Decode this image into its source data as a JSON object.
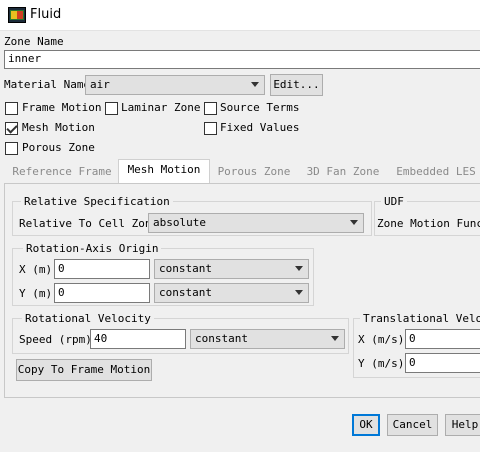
{
  "window": {
    "title": "Fluid",
    "icon": "fluent-app-icon"
  },
  "zone_name": {
    "label": "Zone Name",
    "value": "inner"
  },
  "material": {
    "label": "Material Name",
    "value": "air",
    "edit_button": "Edit..."
  },
  "options": [
    {
      "label": "Frame Motion",
      "checked": false
    },
    {
      "label": "Laminar Zone",
      "checked": false
    },
    {
      "label": "Source Terms",
      "checked": false
    },
    {
      "label": "Mesh Motion",
      "checked": true
    },
    {
      "label": "Fixed Values",
      "checked": false
    },
    {
      "label": "Porous Zone",
      "checked": false
    }
  ],
  "tabs": [
    "Reference Frame",
    "Mesh Motion",
    "Porous Zone",
    "3D Fan Zone",
    "Embedded LES"
  ],
  "active_tab": "Mesh Motion",
  "relative_spec": {
    "title": "Relative Specification",
    "label": "Relative To Cell Zone",
    "value": "absolute"
  },
  "udf": {
    "title": "UDF",
    "label": "Zone Motion Funct"
  },
  "rotation_axis": {
    "title": "Rotation-Axis Origin",
    "x": {
      "label": "X (m)",
      "value": "0",
      "profile": "constant"
    },
    "y": {
      "label": "Y (m)",
      "value": "0",
      "profile": "constant"
    }
  },
  "rotational_velocity": {
    "title": "Rotational Velocity",
    "speed": {
      "label": "Speed (rpm)",
      "value": "40",
      "profile": "constant"
    }
  },
  "translational_velocity": {
    "title": "Translational Veloc",
    "x": {
      "label": "X (m/s)",
      "value": "0"
    },
    "y": {
      "label": "Y (m/s)",
      "value": "0"
    }
  },
  "copy_button": "Copy To Frame Motion",
  "footer": {
    "ok": "OK",
    "cancel": "Cancel",
    "help": "Help"
  }
}
